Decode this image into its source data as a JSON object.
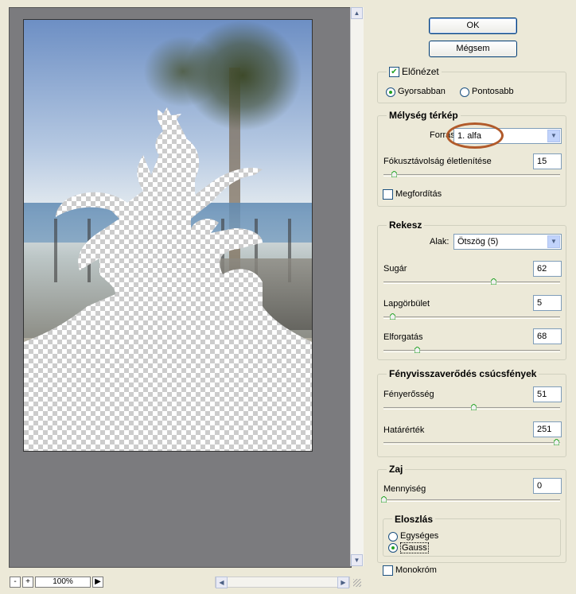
{
  "buttons": {
    "ok": "OK",
    "cancel": "Mégsem"
  },
  "preview": {
    "checkbox_label": "Előnézet",
    "checked": true,
    "mode_fast": "Gyorsabban",
    "mode_accurate": "Pontosabb",
    "selected_mode": "Gyorsabban"
  },
  "depth_map": {
    "title": "Mélység térkép",
    "source_label": "Forrás:",
    "source_value": "1. alfa",
    "blur_focal_label": "Fókusztávolság életlenítése",
    "blur_focal_value": "15",
    "invert_label": "Megfordítás",
    "invert_checked": false
  },
  "iris": {
    "title": "Rekesz",
    "shape_label": "Alak:",
    "shape_value": "Ötszög (5)",
    "radius_label": "Sugár",
    "radius_value": "62",
    "blade_curvature_label": "Lapgörbület",
    "blade_curvature_value": "5",
    "rotation_label": "Elforgatás",
    "rotation_value": "68"
  },
  "specular": {
    "title": "Fényvisszaverődés csúcsfények",
    "brightness_label": "Fényerősség",
    "brightness_value": "51",
    "threshold_label": "Határérték",
    "threshold_value": "251"
  },
  "noise": {
    "title": "Zaj",
    "amount_label": "Mennyiség",
    "amount_value": "0",
    "distribution_title": "Eloszlás",
    "uniform_label": "Egységes",
    "gaussian_label": "Gauss",
    "selected_distribution": "Gauss",
    "monochrome_label": "Monokróm",
    "monochrome_checked": false
  },
  "status": {
    "zoom": "100%",
    "zoom_out": "-",
    "zoom_in": "+"
  },
  "colors": {
    "accent_green": "#21a121",
    "canvas_gray": "#7b7b7e",
    "highlight_oval": "#b15a2a"
  }
}
